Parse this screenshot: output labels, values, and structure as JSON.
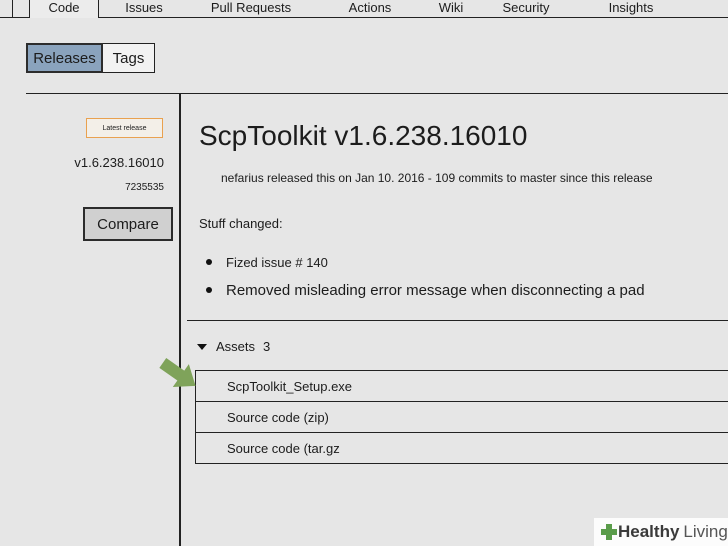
{
  "tabs": [
    {
      "label": "Code",
      "active": true
    },
    {
      "label": "Issues"
    },
    {
      "label": "Pull Requests"
    },
    {
      "label": "Actions"
    },
    {
      "label": "Wiki"
    },
    {
      "label": "Security"
    },
    {
      "label": "Insights"
    }
  ],
  "toggle": {
    "releases": "Releases",
    "tags": "Tags"
  },
  "sidebar": {
    "badge": "Latest release",
    "tag": "v1.6.238.16010",
    "commit": "7235535",
    "compare": "Compare"
  },
  "release": {
    "title": "ScpToolkit v1.6.238.16010",
    "meta": "nefarius released this on Jan 10. 2016 - 109 commits to master since this release",
    "notes_heading": "Stuff changed:",
    "notes": [
      "Fized issue # 140",
      "Removed misleading error message when disconnecting a pad"
    ]
  },
  "assets": {
    "label": "Assets",
    "count": "3",
    "items": [
      "ScpToolkit_Setup.exe",
      "Source code (zip)",
      "Source code (tar.gz"
    ]
  },
  "watermark": {
    "brand": "Healthy",
    "brand2": "Living"
  },
  "colors": {
    "accent_arrow": "#7fa35a",
    "releases_active": "#8aa3bd",
    "badge_border": "#e9a14f"
  }
}
